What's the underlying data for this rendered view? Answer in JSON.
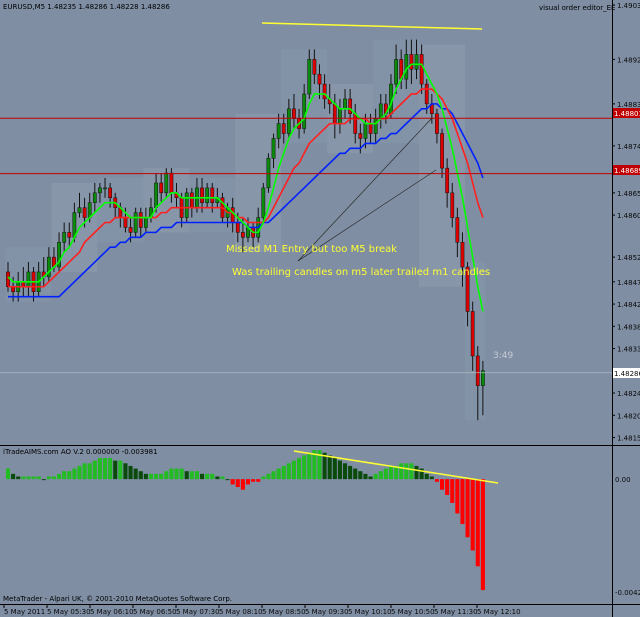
{
  "header": {
    "symbol_info": "EURUSD,M5  1.48235 1.48286 1.48228 1.48286",
    "indicator_name": "visual order editor_EE"
  },
  "indicator_header": "iTradeAIMS.com AO V.2 0.000000 -0.003981",
  "footer_credit": "MetaTrader - Alpari UK, © 2001-2010 MetaQuotes Software Corp.",
  "annotations": {
    "note1": "Missed M1 Entry but too M5 break",
    "note2": "Was trailing candles on m5 later trailed m1 candles",
    "timer": "3:49"
  },
  "price_marks": {
    "level1": "1.48801",
    "level2": "1.48689",
    "current": "1.48286"
  },
  "colors": {
    "background": "#7f8ea3",
    "bull_candle": "#0a8a0a",
    "bear_candle": "#dd0000",
    "ma_fast": "#00ff00",
    "ma_mid": "#ff2020",
    "ma_slow": "#0022ff",
    "trendline": "#ffff33",
    "levels": "#c00000",
    "ao_up": "#22bb22",
    "ao_down": "#ff0000",
    "ao_dark": "#0a4a0a"
  },
  "chart_data": [
    {
      "type": "candlestick",
      "title": "EURUSD,M5",
      "ylim": [
        1.4815,
        1.4903
      ],
      "yticks": [
        "1.49030",
        "1.48920",
        "1.48830",
        "1.48745",
        "1.48650",
        "1.48605",
        "1.48520",
        "1.48470",
        "1.48425",
        "1.48380",
        "1.48335",
        "1.48290",
        "1.48245",
        "1.48200",
        "1.48155"
      ],
      "ytick_values": [
        1.4903,
        1.4892,
        1.4883,
        1.48745,
        1.4865,
        1.48605,
        1.4852,
        1.4847,
        1.48425,
        1.4838,
        1.48335,
        1.4829,
        1.48245,
        1.482,
        1.48155
      ],
      "xticks": [
        "5 May 2011",
        "5 May 05:30",
        "5 May 06:10",
        "5 May 06:50",
        "5 May 07:30",
        "5 May 08:10",
        "5 May 08:50",
        "5 May 09:30",
        "5 May 10:10",
        "5 May 10:50",
        "5 May 11:30",
        "5 May 12:10"
      ],
      "horizontal_levels": [
        1.48801,
        1.48689
      ],
      "current_price": 1.48286,
      "candles": [
        [
          1.4849,
          1.4846,
          1.4851,
          1.4845
        ],
        [
          1.4846,
          1.4845,
          1.4848,
          1.4843
        ],
        [
          1.4845,
          1.4847,
          1.4849,
          1.4843
        ],
        [
          1.4847,
          1.4846,
          1.485,
          1.4844
        ],
        [
          1.4846,
          1.4849,
          1.4851,
          1.4844
        ],
        [
          1.4849,
          1.4845,
          1.485,
          1.4843
        ],
        [
          1.4845,
          1.4849,
          1.4851,
          1.4844
        ],
        [
          1.4849,
          1.4848,
          1.4852,
          1.4846
        ],
        [
          1.4848,
          1.4852,
          1.4854,
          1.4847
        ],
        [
          1.4852,
          1.485,
          1.4854,
          1.4849
        ],
        [
          1.485,
          1.4855,
          1.4857,
          1.4849
        ],
        [
          1.4855,
          1.4857,
          1.4859,
          1.4853
        ],
        [
          1.4857,
          1.4856,
          1.4859,
          1.4854
        ],
        [
          1.4856,
          1.4861,
          1.4863,
          1.4855
        ],
        [
          1.4861,
          1.4862,
          1.4865,
          1.486
        ],
        [
          1.4862,
          1.486,
          1.4864,
          1.4858
        ],
        [
          1.486,
          1.4863,
          1.4865,
          1.4859
        ],
        [
          1.4863,
          1.4865,
          1.4867,
          1.4861
        ],
        [
          1.4865,
          1.4866,
          1.4867,
          1.4863
        ],
        [
          1.4866,
          1.4866,
          1.4868,
          1.4864
        ],
        [
          1.4866,
          1.4864,
          1.4867,
          1.4862
        ],
        [
          1.4864,
          1.4862,
          1.4865,
          1.486
        ],
        [
          1.4862,
          1.486,
          1.4863,
          1.4858
        ],
        [
          1.486,
          1.4858,
          1.4862,
          1.4857
        ],
        [
          1.4858,
          1.4857,
          1.486,
          1.4855
        ],
        [
          1.4857,
          1.4861,
          1.4862,
          1.4856
        ],
        [
          1.4861,
          1.4858,
          1.4862,
          1.4856
        ],
        [
          1.4858,
          1.486,
          1.4862,
          1.4857
        ],
        [
          1.486,
          1.4862,
          1.4864,
          1.4859
        ],
        [
          1.4862,
          1.4867,
          1.4869,
          1.4861
        ],
        [
          1.4867,
          1.4865,
          1.4869,
          1.4863
        ],
        [
          1.4865,
          1.4869,
          1.487,
          1.4864
        ],
        [
          1.4869,
          1.4865,
          1.487,
          1.4863
        ],
        [
          1.4865,
          1.4864,
          1.4867,
          1.4862
        ],
        [
          1.4864,
          1.486,
          1.4865,
          1.4858
        ],
        [
          1.486,
          1.4865,
          1.4866,
          1.4859
        ],
        [
          1.4865,
          1.4862,
          1.4866,
          1.486
        ],
        [
          1.4862,
          1.4866,
          1.4868,
          1.4861
        ],
        [
          1.4866,
          1.4863,
          1.4868,
          1.4861
        ],
        [
          1.4863,
          1.4866,
          1.4867,
          1.4862
        ],
        [
          1.4866,
          1.4863,
          1.4867,
          1.4861
        ],
        [
          1.4863,
          1.4864,
          1.4866,
          1.4862
        ],
        [
          1.4864,
          1.486,
          1.4865,
          1.4859
        ],
        [
          1.486,
          1.4862,
          1.4863,
          1.4858
        ],
        [
          1.4862,
          1.4859,
          1.4864,
          1.4857
        ],
        [
          1.4859,
          1.4857,
          1.4861,
          1.4855
        ],
        [
          1.4857,
          1.4856,
          1.486,
          1.4853
        ],
        [
          1.4856,
          1.4858,
          1.486,
          1.4855
        ],
        [
          1.4858,
          1.4856,
          1.4859,
          1.4854
        ],
        [
          1.4856,
          1.486,
          1.4862,
          1.4855
        ],
        [
          1.486,
          1.4866,
          1.4867,
          1.4859
        ],
        [
          1.4866,
          1.4872,
          1.4873,
          1.4865
        ],
        [
          1.4872,
          1.4876,
          1.4877,
          1.487
        ],
        [
          1.4876,
          1.4879,
          1.4881,
          1.4874
        ],
        [
          1.4879,
          1.4877,
          1.4881,
          1.4875
        ],
        [
          1.4877,
          1.4882,
          1.4884,
          1.4876
        ],
        [
          1.4882,
          1.488,
          1.4885,
          1.4878
        ],
        [
          1.488,
          1.4878,
          1.4882,
          1.4876
        ],
        [
          1.4878,
          1.4885,
          1.4887,
          1.4877
        ],
        [
          1.4885,
          1.4892,
          1.4894,
          1.4884
        ],
        [
          1.4892,
          1.4889,
          1.4894,
          1.4887
        ],
        [
          1.4889,
          1.4887,
          1.4891,
          1.4884
        ],
        [
          1.4887,
          1.4884,
          1.4889,
          1.4882
        ],
        [
          1.4884,
          1.4883,
          1.4887,
          1.4881
        ],
        [
          1.4883,
          1.4879,
          1.4885,
          1.4876
        ],
        [
          1.4879,
          1.4882,
          1.4884,
          1.4877
        ],
        [
          1.4882,
          1.4884,
          1.4886,
          1.488
        ],
        [
          1.4884,
          1.4881,
          1.4886,
          1.4879
        ],
        [
          1.4881,
          1.4877,
          1.4883,
          1.4875
        ],
        [
          1.4877,
          1.4876,
          1.4879,
          1.4873
        ],
        [
          1.4876,
          1.4879,
          1.4881,
          1.4874
        ],
        [
          1.4879,
          1.4877,
          1.4881,
          1.4875
        ],
        [
          1.4877,
          1.488,
          1.4882,
          1.4875
        ],
        [
          1.488,
          1.4883,
          1.4885,
          1.4878
        ],
        [
          1.4883,
          1.4881,
          1.4885,
          1.4879
        ],
        [
          1.4881,
          1.4887,
          1.4889,
          1.488
        ],
        [
          1.4887,
          1.4892,
          1.4895,
          1.4885
        ],
        [
          1.4892,
          1.4888,
          1.4894,
          1.4886
        ],
        [
          1.4888,
          1.4893,
          1.4896,
          1.4886
        ],
        [
          1.4893,
          1.489,
          1.4896,
          1.4887
        ],
        [
          1.489,
          1.4893,
          1.4896,
          1.4888
        ],
        [
          1.4893,
          1.4887,
          1.4895,
          1.4885
        ],
        [
          1.4887,
          1.4883,
          1.4888,
          1.4881
        ],
        [
          1.4883,
          1.4881,
          1.4885,
          1.4879
        ],
        [
          1.4881,
          1.4877,
          1.4882,
          1.4875
        ],
        [
          1.4877,
          1.487,
          1.4878,
          1.4868
        ],
        [
          1.487,
          1.4865,
          1.4872,
          1.4862
        ],
        [
          1.4865,
          1.486,
          1.4867,
          1.4858
        ],
        [
          1.486,
          1.4855,
          1.4862,
          1.4852
        ],
        [
          1.4855,
          1.485,
          1.4857,
          1.4846
        ],
        [
          1.485,
          1.4841,
          1.4851,
          1.4838
        ],
        [
          1.4841,
          1.4832,
          1.4843,
          1.4829
        ],
        [
          1.4832,
          1.4826,
          1.4834,
          1.4819
        ],
        [
          1.4826,
          1.4829,
          1.4831,
          1.482
        ]
      ],
      "ma_fast": [
        1.4848,
        1.4847,
        1.4847,
        1.4847,
        1.4847,
        1.4847,
        1.4847,
        1.4848,
        1.4849,
        1.485,
        1.4851,
        1.4853,
        1.4854,
        1.4856,
        1.4858,
        1.4859,
        1.486,
        1.4861,
        1.4862,
        1.4863,
        1.4863,
        1.4863,
        1.4862,
        1.4861,
        1.486,
        1.486,
        1.486,
        1.486,
        1.486,
        1.4862,
        1.4863,
        1.4864,
        1.4865,
        1.4865,
        1.4864,
        1.4864,
        1.4864,
        1.4864,
        1.4864,
        1.4864,
        1.4864,
        1.4864,
        1.4863,
        1.4862,
        1.4861,
        1.486,
        1.4859,
        1.4858,
        1.4857,
        1.4857,
        1.4859,
        1.4862,
        1.4866,
        1.487,
        1.4873,
        1.4876,
        1.4878,
        1.4879,
        1.488,
        1.4883,
        1.4885,
        1.4885,
        1.4885,
        1.4884,
        1.4883,
        1.4882,
        1.4882,
        1.4882,
        1.4881,
        1.488,
        1.4879,
        1.4879,
        1.4879,
        1.488,
        1.4881,
        1.4883,
        1.4886,
        1.4888,
        1.489,
        1.4891,
        1.4891,
        1.4891,
        1.4889,
        1.4887,
        1.4885,
        1.4882,
        1.4878,
        1.4874,
        1.4869,
        1.4864,
        1.4858,
        1.4852,
        1.4846,
        1.4841
      ],
      "ma_mid": [
        1.4846,
        1.4846,
        1.4846,
        1.4846,
        1.4846,
        1.4846,
        1.4846,
        1.4846,
        1.4847,
        1.4848,
        1.4849,
        1.485,
        1.4851,
        1.4852,
        1.4853,
        1.4855,
        1.4856,
        1.4857,
        1.4858,
        1.4859,
        1.4859,
        1.486,
        1.486,
        1.486,
        1.486,
        1.486,
        1.486,
        1.486,
        1.486,
        1.486,
        1.4861,
        1.4861,
        1.4862,
        1.4862,
        1.4862,
        1.4862,
        1.4862,
        1.4862,
        1.4862,
        1.4862,
        1.4862,
        1.4862,
        1.4862,
        1.4861,
        1.4861,
        1.486,
        1.486,
        1.4859,
        1.4859,
        1.4859,
        1.4859,
        1.486,
        1.4862,
        1.4864,
        1.4866,
        1.4868,
        1.487,
        1.4871,
        1.4873,
        1.4875,
        1.4876,
        1.4877,
        1.4878,
        1.4879,
        1.4879,
        1.4879,
        1.4879,
        1.488,
        1.488,
        1.488,
        1.488,
        1.4879,
        1.4879,
        1.488,
        1.488,
        1.4881,
        1.4882,
        1.4883,
        1.4884,
        1.4885,
        1.4885,
        1.4886,
        1.4886,
        1.4886,
        1.4885,
        1.4884,
        1.4882,
        1.488,
        1.4877,
        1.4874,
        1.4871,
        1.4867,
        1.4863,
        1.486
      ],
      "ma_slow": [
        1.4844,
        1.4844,
        1.4844,
        1.4844,
        1.4844,
        1.4844,
        1.4844,
        1.4844,
        1.4844,
        1.4844,
        1.4844,
        1.4845,
        1.4846,
        1.4847,
        1.4848,
        1.4849,
        1.485,
        1.4851,
        1.4852,
        1.4853,
        1.4854,
        1.4854,
        1.4855,
        1.4855,
        1.4856,
        1.4856,
        1.4856,
        1.4857,
        1.4857,
        1.4857,
        1.4858,
        1.4858,
        1.4858,
        1.4859,
        1.4859,
        1.4859,
        1.4859,
        1.4859,
        1.4859,
        1.4859,
        1.4859,
        1.4859,
        1.4859,
        1.4859,
        1.4859,
        1.4859,
        1.4859,
        1.4858,
        1.4858,
        1.4858,
        1.4859,
        1.4859,
        1.486,
        1.4861,
        1.4862,
        1.4863,
        1.4864,
        1.4865,
        1.4866,
        1.4867,
        1.4868,
        1.4869,
        1.487,
        1.4871,
        1.4872,
        1.4873,
        1.4873,
        1.4874,
        1.4874,
        1.4874,
        1.4875,
        1.4875,
        1.4875,
        1.4876,
        1.4876,
        1.4877,
        1.4877,
        1.4878,
        1.4879,
        1.488,
        1.4881,
        1.4882,
        1.4882,
        1.4883,
        1.4883,
        1.4882,
        1.4882,
        1.4881,
        1.4879,
        1.4877,
        1.4875,
        1.4873,
        1.4871,
        1.4868
      ]
    },
    {
      "type": "bar",
      "title": "iTradeAIMS.com AO V.2",
      "ylim": [
        -0.0045,
        0.0008
      ],
      "yticks": [
        "0.00",
        "-0.004271"
      ],
      "ytick_values": [
        0.0,
        -0.004271
      ],
      "values": [
        0.0004,
        0.0002,
        0.0001,
        0.0001,
        0.0001,
        0.0001,
        0.0001,
        0.0,
        0.0001,
        0.0001,
        0.0002,
        0.0003,
        0.0003,
        0.0004,
        0.0005,
        0.0006,
        0.0006,
        0.0007,
        0.0008,
        0.0008,
        0.0008,
        0.0007,
        0.0007,
        0.0006,
        0.0005,
        0.0004,
        0.0003,
        0.0002,
        0.0002,
        0.0002,
        0.0002,
        0.0003,
        0.0004,
        0.0004,
        0.0004,
        0.0003,
        0.0003,
        0.0003,
        0.0002,
        0.0002,
        0.0002,
        0.0001,
        0.0001,
        0.0,
        -0.0002,
        -0.0003,
        -0.0004,
        -0.0002,
        -0.0001,
        -0.0001,
        0.0001,
        0.0002,
        0.0003,
        0.0004,
        0.0005,
        0.0006,
        0.0007,
        0.0008,
        0.0009,
        0.001,
        0.0011,
        0.0011,
        0.001,
        0.0009,
        0.0008,
        0.0007,
        0.0006,
        0.0005,
        0.0004,
        0.0003,
        0.0002,
        0.0001,
        0.0002,
        0.0003,
        0.0004,
        0.0005,
        0.0005,
        0.0006,
        0.0006,
        0.0006,
        0.0005,
        0.0004,
        0.0002,
        0.0001,
        -0.0001,
        -0.0004,
        -0.0006,
        -0.0009,
        -0.0013,
        -0.0017,
        -0.0022,
        -0.0027,
        -0.0033,
        -0.0042
      ]
    }
  ]
}
